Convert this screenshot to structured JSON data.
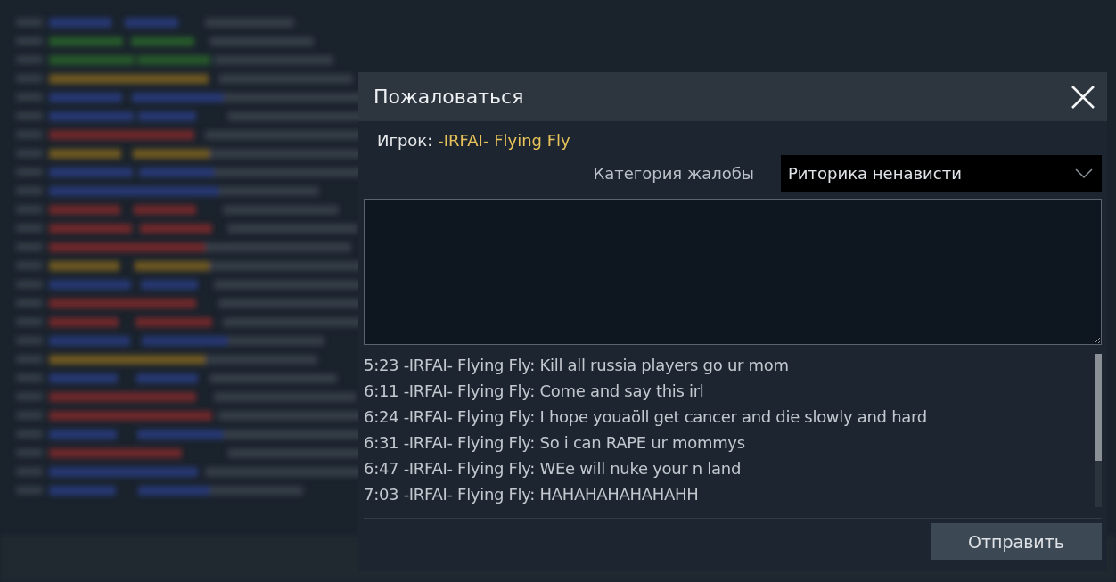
{
  "dialog": {
    "title": "Пожаловаться",
    "player_label": "Игрок:",
    "player_name": "-IRFAI- Flying Fly",
    "category_label": "Категория жалобы",
    "category_value": "Риторика ненависти",
    "chat": [
      {
        "text": "5:23 -IRFAI- Flying Fly: Kill all russia players go ur mom"
      },
      {
        "text": "6:11 -IRFAI- Flying Fly: Come and say this irl"
      },
      {
        "text": "6:24 -IRFAI- Flying Fly: I hope youaöll get cancer and die slowly and hard"
      },
      {
        "text": "6:31 -IRFAI- Flying Fly: So i can RAPE ur mommys"
      },
      {
        "text": "6:47 -IRFAI- Flying Fly: WEe will nuke your n land"
      },
      {
        "text": "7:03 -IRFAI- Flying Fly: HAHAHAHAHAHAHH"
      }
    ],
    "submit": "Отправить"
  }
}
